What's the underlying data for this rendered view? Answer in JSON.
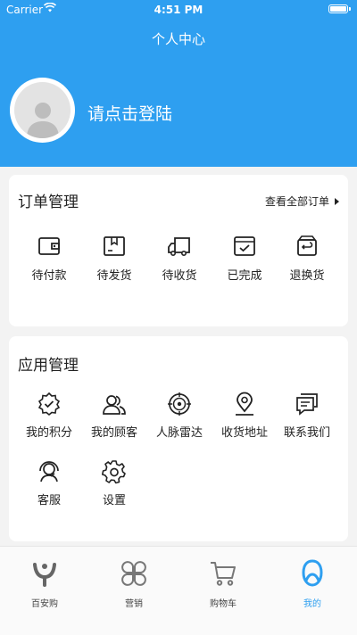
{
  "status_bar": {
    "carrier": "Carrier",
    "time": "4:51 PM"
  },
  "header": {
    "title": "个人中心",
    "login_prompt": "请点击登陆"
  },
  "orders": {
    "title": "订单管理",
    "view_all": "查看全部订单",
    "items": [
      {
        "label": "待付款",
        "icon": "wallet-icon"
      },
      {
        "label": "待发货",
        "icon": "package-icon"
      },
      {
        "label": "待收货",
        "icon": "truck-icon"
      },
      {
        "label": "已完成",
        "icon": "check-box-icon"
      },
      {
        "label": "退换货",
        "icon": "return-box-icon"
      }
    ]
  },
  "apps": {
    "title": "应用管理",
    "items": [
      {
        "label": "我的积分",
        "icon": "badge-check-icon"
      },
      {
        "label": "我的顾客",
        "icon": "customers-icon"
      },
      {
        "label": "人脉雷达",
        "icon": "radar-icon"
      },
      {
        "label": "收货地址",
        "icon": "location-pin-icon"
      },
      {
        "label": "联系我们",
        "icon": "message-icon"
      },
      {
        "label": "客服",
        "icon": "customer-service-icon"
      },
      {
        "label": "设置",
        "icon": "gear-icon"
      }
    ]
  },
  "tabbar": {
    "active_color": "#2e9ff0",
    "items": [
      {
        "label": "百安购",
        "icon": "home-logo-icon"
      },
      {
        "label": "营销",
        "icon": "grid-petals-icon"
      },
      {
        "label": "购物车",
        "icon": "cart-icon"
      },
      {
        "label": "我的",
        "icon": "profile-icon",
        "active": true
      }
    ]
  }
}
